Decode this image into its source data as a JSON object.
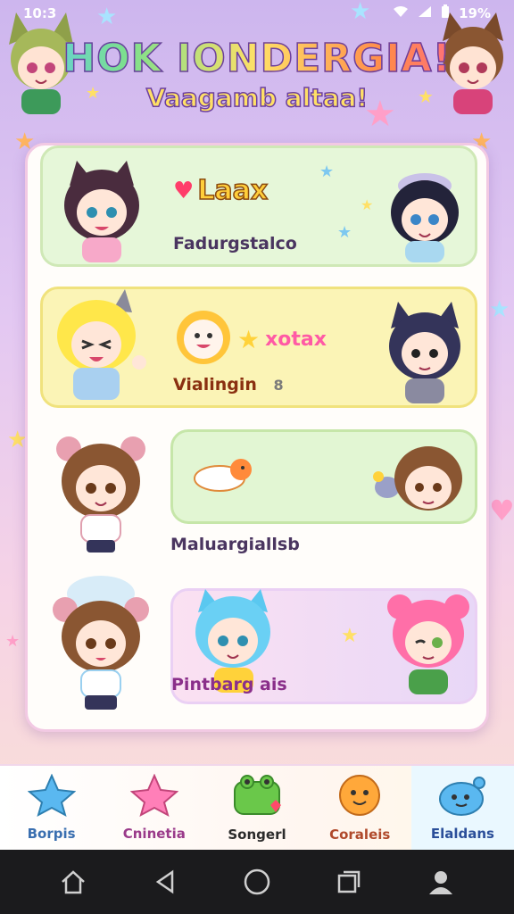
{
  "status_bar": {
    "time": "10:3",
    "battery": "19%"
  },
  "header": {
    "title": "HOK IONDERGIA!",
    "subtitle": "Vaagamb altaa!"
  },
  "cards": [
    {
      "badge": "Laax",
      "label": "Fadurgstalco"
    },
    {
      "badge": "xotax",
      "label": "Vialingin",
      "note": "8"
    },
    {
      "label": "Maluargiallsb"
    },
    {
      "label": "Pintbarg ais"
    }
  ],
  "bottom_nav": [
    {
      "label": "Borpis",
      "color": "#3a6fb0"
    },
    {
      "label": "Cninetia",
      "color": "#9a3a8a"
    },
    {
      "label": "Songerl",
      "color": "#2b2b2b"
    },
    {
      "label": "Coraleis",
      "color": "#b0492b"
    },
    {
      "label": "Elaldans",
      "color": "#2b4f9a"
    }
  ],
  "colors": {
    "accent": "#ff5aa5",
    "panel": "#fffdfa"
  }
}
